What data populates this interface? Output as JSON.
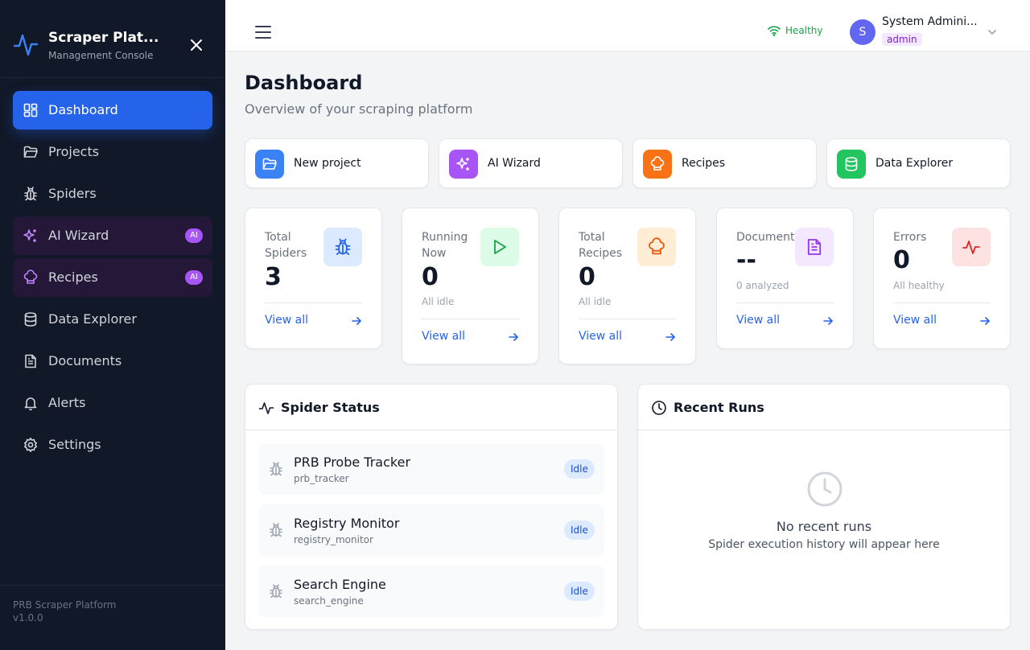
{
  "sidebar": {
    "brand_title": "Scraper Plat...",
    "brand_subtitle": "Management Console",
    "items": [
      {
        "label": "Dashboard"
      },
      {
        "label": "Projects"
      },
      {
        "label": "Spiders"
      },
      {
        "label": "AI Wizard",
        "badge": "AI"
      },
      {
        "label": "Recipes",
        "badge": "AI"
      },
      {
        "label": "Data Explorer"
      },
      {
        "label": "Documents"
      },
      {
        "label": "Alerts"
      },
      {
        "label": "Settings"
      }
    ],
    "footer_name": "PRB Scraper Platform",
    "footer_version": "v1.0.0"
  },
  "header": {
    "health": "Healthy",
    "user_initial": "S",
    "user_name": "System Admini...",
    "user_role": "admin"
  },
  "page": {
    "title": "Dashboard",
    "subtitle": "Overview of your scraping platform"
  },
  "quick_actions": [
    {
      "label": "New project",
      "icon": "folder-open-icon",
      "color": "#3b82f6"
    },
    {
      "label": "AI Wizard",
      "icon": "sparkles-icon",
      "color": "#a855f7"
    },
    {
      "label": "Recipes",
      "icon": "chef-hat-icon",
      "color": "#f97316"
    },
    {
      "label": "Data Explorer",
      "icon": "database-icon",
      "color": "#22c55e"
    }
  ],
  "stats": [
    {
      "label": "Total Spiders",
      "value": "3",
      "note": "",
      "link": "View all",
      "icon": "bug-icon"
    },
    {
      "label": "Running Now",
      "value": "0",
      "note": "All idle",
      "link": "View all",
      "icon": "play-icon"
    },
    {
      "label": "Total Recipes",
      "value": "0",
      "note": "All idle",
      "link": "View all",
      "icon": "chef-hat-icon"
    },
    {
      "label": "Documents",
      "value": "--",
      "note": "0 analyzed",
      "link": "View all",
      "icon": "file-text-icon"
    },
    {
      "label": "Errors",
      "value": "0",
      "note": "All healthy",
      "link": "View all",
      "icon": "activity-icon"
    }
  ],
  "spider_status": {
    "title": "Spider Status",
    "spiders": [
      {
        "name": "PRB Probe Tracker",
        "slug": "prb_tracker",
        "status": "Idle"
      },
      {
        "name": "Registry Monitor",
        "slug": "registry_monitor",
        "status": "Idle"
      },
      {
        "name": "Search Engine",
        "slug": "search_engine",
        "status": "Idle"
      }
    ]
  },
  "recent_runs": {
    "title": "Recent Runs",
    "empty_title": "No recent runs",
    "empty_subtitle": "Spider execution history will appear here"
  },
  "colors": {
    "accent": "#2563eb",
    "sidebar_bg": "#111827",
    "health": "#16a34a",
    "ai_badge": "#a855f7"
  }
}
